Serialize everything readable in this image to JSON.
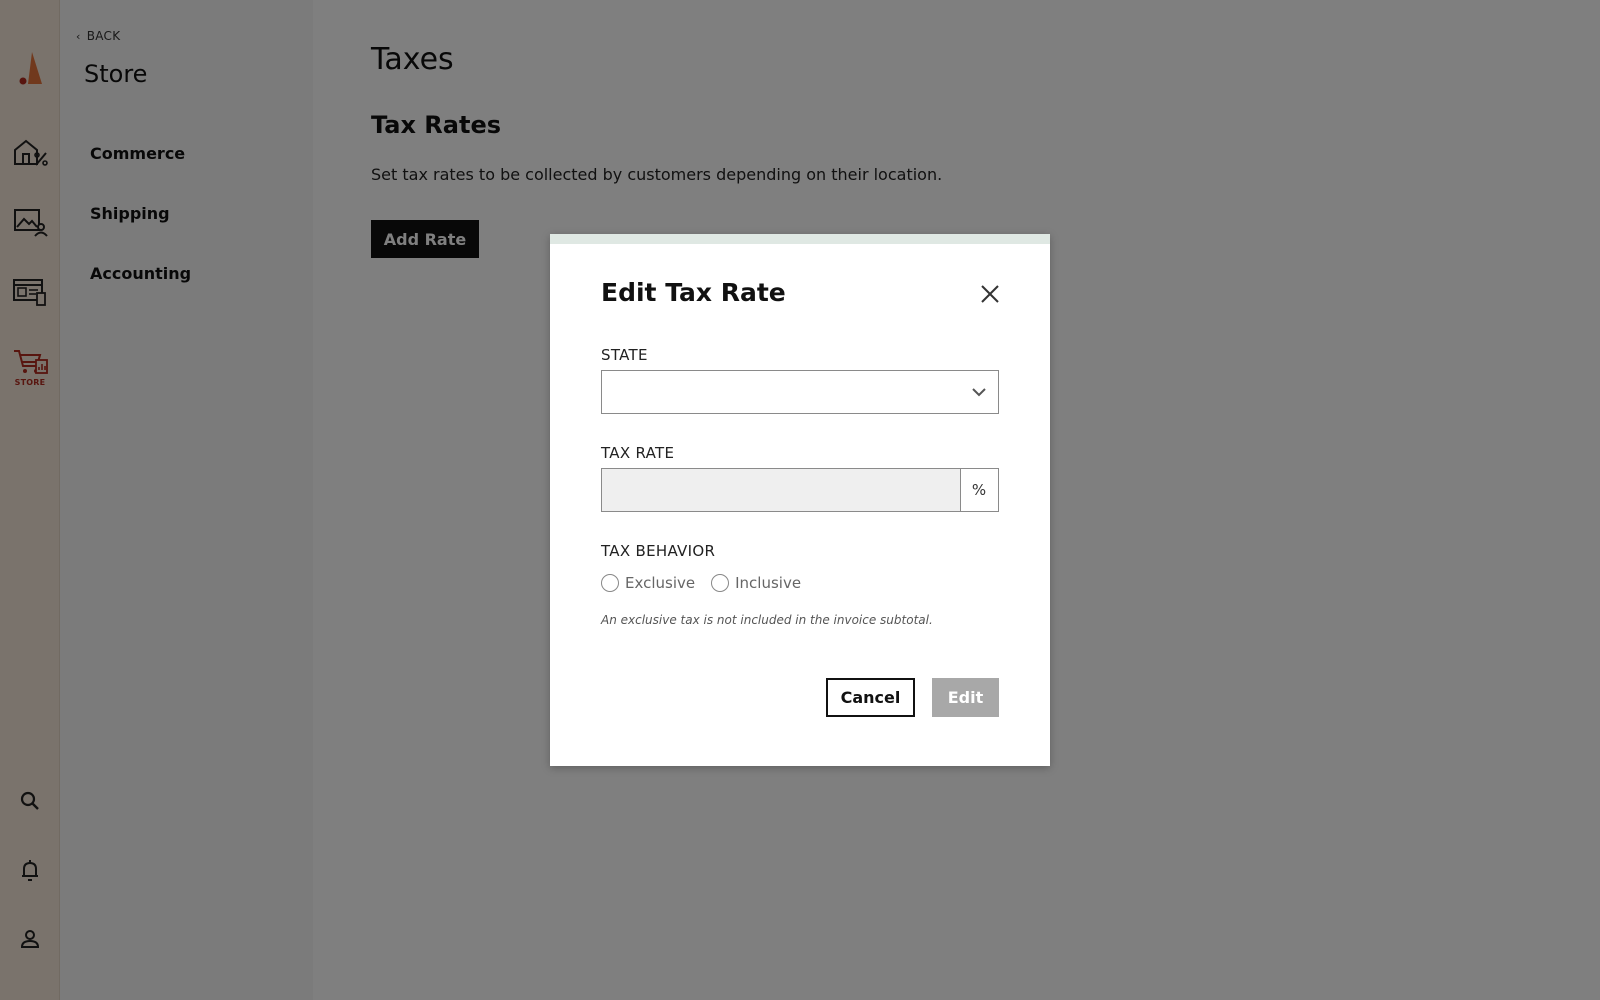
{
  "rail": {
    "active_label": "STORE",
    "accent_color": "#b02a1e"
  },
  "sidebar": {
    "back_label": "BACK",
    "title": "Store",
    "items": [
      {
        "label": "Commerce"
      },
      {
        "label": "Shipping"
      },
      {
        "label": "Accounting"
      }
    ]
  },
  "main": {
    "page_title": "Taxes",
    "section_title": "Tax Rates",
    "section_description": "Set tax rates to be collected by customers depending on their location.",
    "add_button_label": "Add Rate"
  },
  "modal": {
    "title": "Edit Tax Rate",
    "state_label": "STATE",
    "state_value": "",
    "tax_rate_label": "TAX RATE",
    "tax_rate_value": "",
    "tax_rate_unit": "%",
    "tax_behavior_label": "TAX BEHAVIOR",
    "options": [
      {
        "label": "Exclusive",
        "selected": false
      },
      {
        "label": "Inclusive",
        "selected": false
      }
    ],
    "hint": "An exclusive tax is not included in the invoice subtotal.",
    "cancel_label": "Cancel",
    "submit_label": "Edit"
  }
}
